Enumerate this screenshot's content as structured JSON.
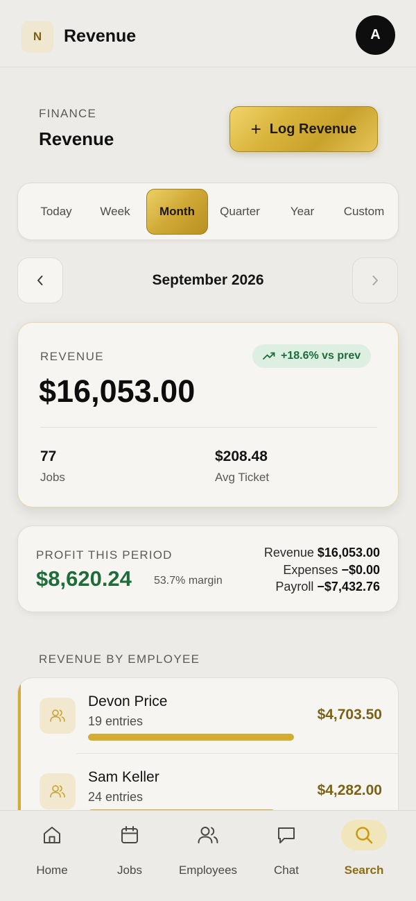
{
  "header": {
    "logo_letter": "N",
    "title": "Revenue",
    "avatar_letter": "A"
  },
  "page": {
    "section_label": "FINANCE",
    "title": "Revenue",
    "log_button_label": "Log Revenue"
  },
  "period_tabs": {
    "items": [
      {
        "label": "Today"
      },
      {
        "label": "Week"
      },
      {
        "label": "Month"
      },
      {
        "label": "Quarter"
      },
      {
        "label": "Year"
      },
      {
        "label": "Custom"
      }
    ],
    "selected": "Month"
  },
  "month_nav": {
    "label": "September 2026",
    "prev_icon": "chevron-left-icon",
    "next_icon": "chevron-right-icon"
  },
  "revenue_card": {
    "label": "REVENUE",
    "amount": "$16,053.00",
    "trend": "+18.6% vs prev",
    "jobs_value": "77",
    "jobs_label": "Jobs",
    "avg_value": "$208.48",
    "avg_label": "Avg Ticket"
  },
  "profit_card": {
    "label": "PROFIT THIS PERIOD",
    "amount": "$8,620.24",
    "margin": "53.7% margin",
    "revenue_label": "Revenue",
    "revenue_value": "$16,053.00",
    "expenses_label": "Expenses",
    "expenses_value": "−$0.00",
    "payroll_label": "Payroll",
    "payroll_value": "−$7,432.76"
  },
  "employees": {
    "heading": "REVENUE BY EMPLOYEE",
    "rows": [
      {
        "name": "Devon Price",
        "entries": "19 entries",
        "amount": "$4,703.50",
        "share": 1.0
      },
      {
        "name": "Sam Keller",
        "entries": "24 entries",
        "amount": "$4,282.00",
        "share": 0.91
      }
    ]
  },
  "bottom_nav": {
    "items": [
      {
        "label": "Home",
        "icon": "home-icon"
      },
      {
        "label": "Jobs",
        "icon": "calendar-icon"
      },
      {
        "label": "Employees",
        "icon": "users-icon"
      },
      {
        "label": "Chat",
        "icon": "chat-icon"
      },
      {
        "label": "Search",
        "icon": "search-icon"
      }
    ],
    "active": "Search"
  },
  "colors": {
    "accent_gold": "#d2ac33",
    "profit_green": "#1f6b3a",
    "trend_bg": "#dcefe0"
  }
}
